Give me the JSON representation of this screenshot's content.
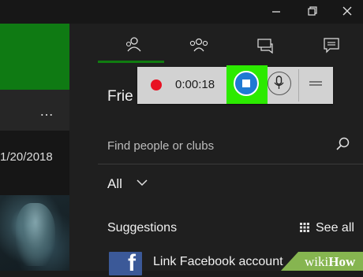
{
  "window": {
    "controls": [
      "minimize-icon",
      "restore-icon",
      "close-icon"
    ]
  },
  "left_pane": {
    "more_label": "…",
    "date": "1/20/2018"
  },
  "social_tabs": [
    "friends-icon",
    "party-icon",
    "messages-icon",
    "activity-feed-icon"
  ],
  "friends_panel": {
    "title": "Frie",
    "search_placeholder": "Find people or clubs",
    "filter_label": "All",
    "suggestions_label": "Suggestions",
    "see_all_label": "See all",
    "facebook_tile_letter": "f",
    "facebook_link": "Link Facebook account"
  },
  "recording_bar": {
    "timer": "0:00:18",
    "record_color": "#e81123",
    "stop_color": "#1f7ad3",
    "highlight_color": "#2cea00"
  },
  "watermark": {
    "wiki": "wiki",
    "how": "How"
  },
  "colors": {
    "accent": "#107c10",
    "background": "#1f1f1f"
  }
}
